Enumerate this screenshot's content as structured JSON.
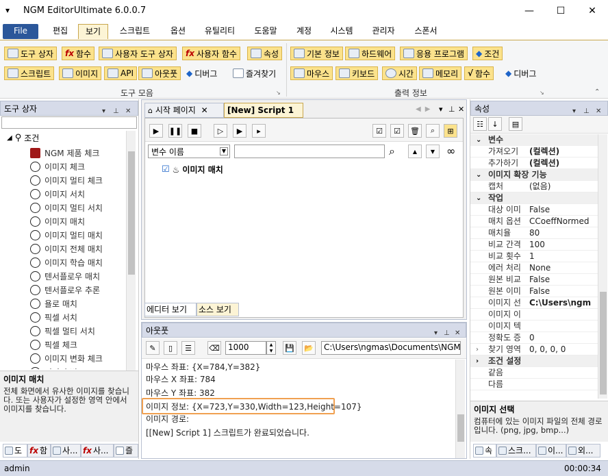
{
  "window": {
    "app": "NGM Editor",
    "edition": "Ultimate 6.0.0.7",
    "minimize": "—",
    "maximize": "☐",
    "close": "✕"
  },
  "menu": [
    "File",
    "편집",
    "보기",
    "스크립트",
    "옵션",
    "유틸리티",
    "도움말",
    "계정",
    "시스템",
    "관리자",
    "스폰서"
  ],
  "ribbon": {
    "row1": [
      "도구 상자",
      "함수",
      "사용자 도구 상자",
      "사용자 함수",
      "속성"
    ],
    "row2": [
      "스크립트",
      "이미지",
      "API",
      "아웃풋",
      "디버그",
      "즐겨찾기"
    ],
    "group1": "도구 모음",
    "row1b": [
      "기본 정보",
      "하드웨어",
      "응용 프로그램",
      "조건"
    ],
    "row2b": [
      "마우스",
      "키보드",
      "시간",
      "메모리",
      "함수",
      "디버그"
    ],
    "group2": "출력 정보"
  },
  "toolbox": {
    "title": "도구 상자",
    "root": "조건",
    "items": [
      "NGM 제품 체크",
      "이미지 체크",
      "이미지 멀티 체크",
      "이미지 서치",
      "이미지 멀티 서치",
      "이미지 매치",
      "이미지 멀티 매치",
      "이미지 전체 매치",
      "이미지 학습 매치",
      "텐서플로우 매치",
      "텐서플로우 추론",
      "욜로 매치",
      "픽셀 서치",
      "픽셀 멀티 서치",
      "픽셀 체크",
      "이미지 변화 체크",
      "이미지 비교"
    ],
    "desc_title": "이미지 매치",
    "desc": "전체 화면에서 유사한 이미지를 찾습니다. 또는 사용자가 설정한 영역 안에서 이미지를 찾습니다.",
    "tabs": [
      "도",
      "함",
      "사...",
      "사...",
      "즐"
    ]
  },
  "document": {
    "tabs": [
      "시작 페이지",
      "[New] Script 1"
    ],
    "var_select": "변수 이름",
    "var_input": "",
    "node": "이미지 매치",
    "bottom_tabs": [
      "에디터 보기",
      "소스 보기"
    ]
  },
  "output": {
    "title": "아웃풋",
    "count": "1000",
    "path": "C:\\Users\\ngmas\\Documents\\NGM6\\",
    "lines": [
      "마우스 좌표: {X=784,Y=382}",
      "마우스 X 좌표: 784",
      "마우스 Y 좌표: 382",
      "이미지 정보: {X=723,Y=330,Width=123,Height=107}",
      "이미지 경로:",
      "[[New] Script 1] 스크립트가 완료되었습니다."
    ]
  },
  "properties": {
    "title": "속성",
    "rows": [
      {
        "cat": true,
        "k": "변수"
      },
      {
        "k": "가져오기",
        "v": "(컬렉션)",
        "b": true
      },
      {
        "k": "추가하기",
        "v": "(컬렉션)",
        "b": true
      },
      {
        "cat": true,
        "k": "이미지 확장 기능"
      },
      {
        "k": "캡처",
        "v": "(없음)"
      },
      {
        "cat": true,
        "k": "작업"
      },
      {
        "k": "대상 이미",
        "v": "False"
      },
      {
        "k": "매치 옵션",
        "v": "CCoeffNormed"
      },
      {
        "k": "매치율",
        "v": "80"
      },
      {
        "k": "비교 간격",
        "v": "100"
      },
      {
        "k": "비교 횟수",
        "v": "1"
      },
      {
        "k": "에러 처리",
        "v": "None"
      },
      {
        "k": "원본 비교",
        "v": "False"
      },
      {
        "k": "원본 이미",
        "v": "False"
      },
      {
        "k": "이미지 선",
        "v": "C:\\Users\\ngm",
        "b": true
      },
      {
        "k": "이미지 이",
        "v": ""
      },
      {
        "k": "이미지 텍",
        "v": ""
      },
      {
        "k": "정확도 증",
        "v": "0"
      },
      {
        "k": "찾기 영역",
        "v": "0, 0, 0, 0"
      },
      {
        "cat": true,
        "k": "조건 설정"
      },
      {
        "k": "같음",
        "v": ""
      },
      {
        "k": "다름",
        "v": ""
      }
    ],
    "desc_title": "이미지 선택",
    "desc": "컴퓨터에 있는 이미지 파일의 전체 경로입니다. (png, jpg, bmp...)",
    "tabs": [
      "속",
      "스크...",
      "이...",
      "외..."
    ]
  },
  "status": {
    "user": "admin",
    "time": "00:00:34"
  }
}
